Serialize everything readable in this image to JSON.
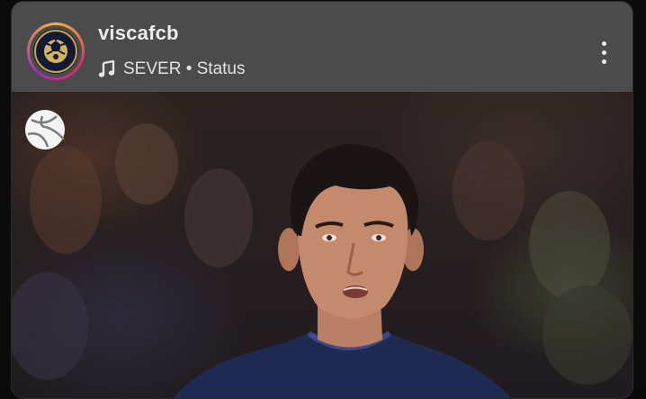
{
  "post": {
    "username": "viscafcb",
    "audio_label": "SEVER • Status",
    "icons": {
      "avatar": "football-club-logo-icon",
      "audio": "music-note-icon",
      "more": "more-options-icon",
      "watermark": "football-ball-icon"
    },
    "photo_alt": "Football player in dark blue kit",
    "colors": {
      "ring_start": "#f5b43a",
      "ring_mid": "#d9305d",
      "ring_end": "#9a2fb8",
      "card_bg": "#4b4b4b",
      "text": "#ececec"
    }
  }
}
